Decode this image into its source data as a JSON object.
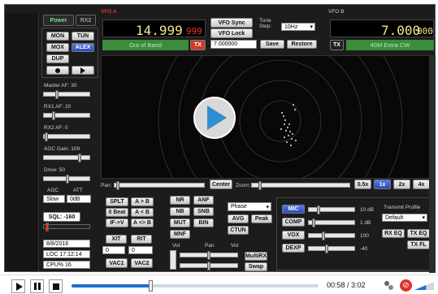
{
  "power": {
    "label": "Power",
    "rx2": "RX2"
  },
  "modes": {
    "mon": "MON",
    "tun": "TUN",
    "mox": "MOX",
    "alex": "ALEX",
    "dup": "DUP"
  },
  "vfo_a": {
    "tag": "VFO A",
    "freq": "14.999",
    "sub": "999",
    "band": "Out of Band",
    "tx": "TX"
  },
  "vfo_b": {
    "tag": "VFO B",
    "freq": "7.000",
    "sub": "000",
    "band": "40M Extra CW",
    "tx": "TX"
  },
  "center": {
    "sync": "VFO Sync",
    "lock": "VFO Lock",
    "tune_step_label": "Tune Step:",
    "tune_step": "10Hz",
    "freq_field": "7.000000",
    "save": "Save",
    "restore": "Restore"
  },
  "left": {
    "master_af": "Master AF: 30",
    "rx1_af": "RX1 AF: 20",
    "rx2_af": "RX2 AF: 0",
    "agc_gain": "AGC Gain: 109",
    "drive": "Drive: 50",
    "agc": "AGC",
    "att": "ATT",
    "agc_val": "Slow",
    "att_val": "0dB",
    "sql": "SQL: -160",
    "date": "8/8/2016",
    "time": "LOC 17:12:14",
    "cpu": "CPU% 16"
  },
  "pan": {
    "pan_label": "Pan:",
    "center": "Center",
    "zoom_label": "Zoom:",
    "z05": "0.5x",
    "z1": "1x",
    "z2": "2x",
    "z4": "4x"
  },
  "bottom_btns": {
    "splt": "SPLT",
    "ab": "A > B",
    "zbeat": "0 Beat",
    "ba": "A < B",
    "ifv": "IF->V",
    "aswap": "A <> B",
    "xit": "XIT",
    "xit_val": "0",
    "rit": "RIT",
    "rit_val": "0",
    "vac1": "VAC1",
    "vac2": "VAC2",
    "nr": "NR",
    "anf": "ANF",
    "nb": "NB",
    "snb": "SNB",
    "mut": "MUT",
    "bin": "BIN",
    "mnf": "MNF",
    "phase": "Phase",
    "avg": "AVG",
    "peak": "Peak",
    "ctun": "CTUN",
    "vol": "Vol",
    "pan2": "Pan",
    "vol2": "Vol",
    "multirx": "MultiRX",
    "swap": "Swap"
  },
  "tx": {
    "mic": "MIC",
    "comp": "COMP",
    "vox": "VOX",
    "dexp": "DEXP",
    "mic_db": "10 dB",
    "comp_db": "1 dB",
    "vox_val": "100",
    "dexp_val": "-40",
    "profile_label": "Transmit Profile",
    "profile": "Default",
    "rx_eq": "RX EQ",
    "tx_eq": "TX EQ",
    "tx_fl": "TX FL"
  },
  "player": {
    "time": "00:58 / 3:02",
    "progress": 0.32,
    "volume": 0.6
  }
}
